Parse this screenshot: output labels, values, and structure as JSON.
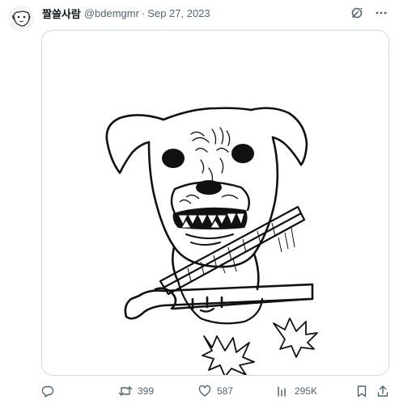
{
  "post": {
    "display_name": "짤쓸사람",
    "handle": "@bdemgmr",
    "separator": "·",
    "date": "Sep 27, 2023"
  },
  "header_icons": [
    "grok-icon",
    "more-icon"
  ],
  "media": {
    "description_icon": "dog-drawing-image"
  },
  "actions": {
    "reply": {
      "icon": "reply-icon",
      "count": ""
    },
    "repost": {
      "icon": "repost-icon",
      "count": "399"
    },
    "like": {
      "icon": "heart-icon",
      "count": "587"
    },
    "views": {
      "icon": "views-icon",
      "count": "295K"
    },
    "bookmark": {
      "icon": "bookmark-icon",
      "count": ""
    },
    "share": {
      "icon": "share-icon",
      "count": ""
    }
  },
  "colors": {
    "text_primary": "#0f1419",
    "text_secondary": "#536471",
    "border": "#cfd9de",
    "background": "#ffffff"
  }
}
